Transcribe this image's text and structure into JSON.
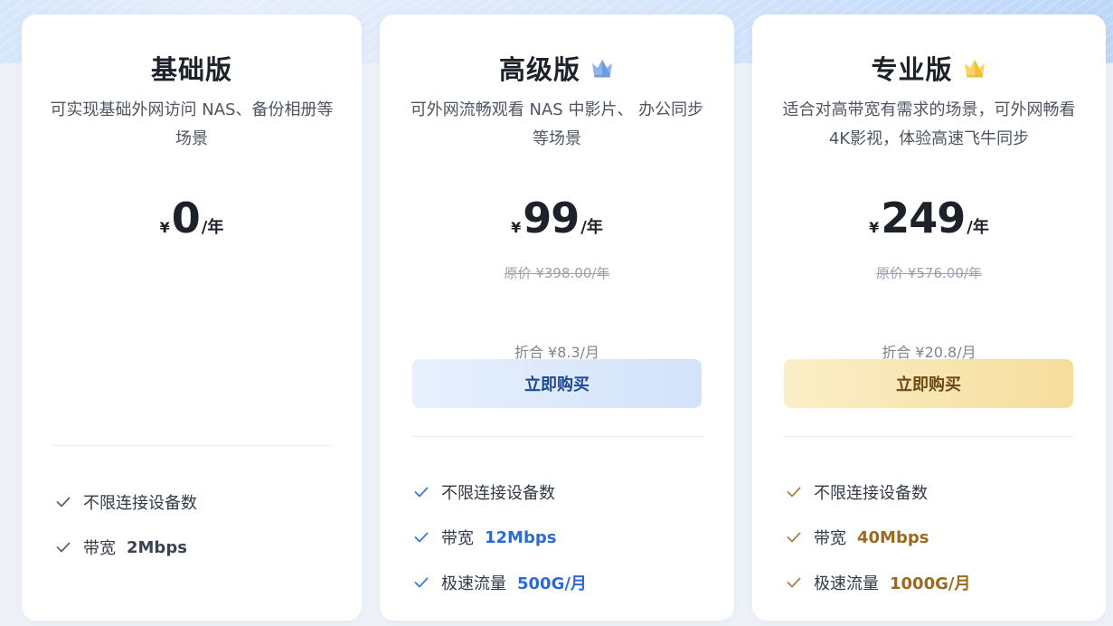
{
  "plans": [
    {
      "name": "基础版",
      "description": "可实现基础外网访问 NAS、备份相册等场景",
      "currency": "¥",
      "price": "0",
      "per": "/年",
      "features": [
        {
          "label": "不限连接设备数",
          "value": ""
        },
        {
          "label": "带宽",
          "value": "2Mbps"
        }
      ]
    },
    {
      "name": "高级版",
      "badge_icon": "crown-blue-icon",
      "description": "可外网流畅观看 NAS 中影片、 办公同步等场景",
      "currency": "¥",
      "price": "99",
      "per": "/年",
      "original_price": "原价 ¥398.00/年",
      "monthly": "折合 ¥8.3/月",
      "buy_label": "立即购买",
      "accent_color": "#2e6bd0",
      "features": [
        {
          "label": "不限连接设备数",
          "value": ""
        },
        {
          "label": "带宽",
          "value": "12Mbps"
        },
        {
          "label": "极速流量",
          "value": "500G/月"
        }
      ]
    },
    {
      "name": "专业版",
      "badge_icon": "crown-gold-icon",
      "description": "适合对高带宽有需求的场景，可外网畅看4K影视，体验高速飞牛同步",
      "currency": "¥",
      "price": "249",
      "per": "/年",
      "original_price": "原价 ¥576.00/年",
      "monthly": "折合 ¥20.8/月",
      "buy_label": "立即购买",
      "accent_color": "#9a6a1e",
      "features": [
        {
          "label": "不限连接设备数",
          "value": ""
        },
        {
          "label": "带宽",
          "value": "40Mbps"
        },
        {
          "label": "极速流量",
          "value": "1000G/月"
        }
      ]
    }
  ]
}
